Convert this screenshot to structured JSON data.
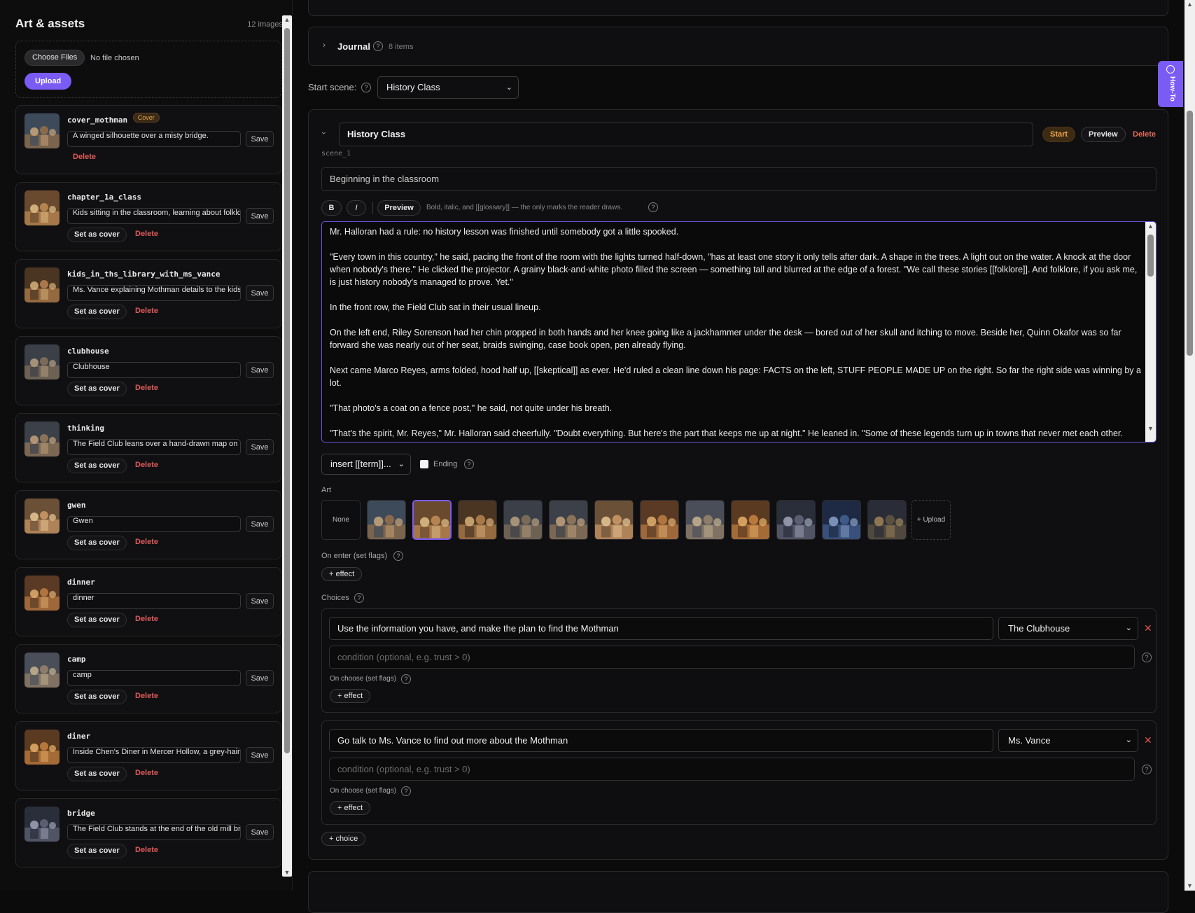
{
  "sidebar": {
    "title": "Art & assets",
    "count": "12 images",
    "choose_files": "Choose Files",
    "no_file": "No file chosen",
    "upload": "Upload",
    "save_label": "Save",
    "set_cover_label": "Set as cover",
    "delete_label": "Delete",
    "cover_badge": "Cover",
    "assets": [
      {
        "name": "cover_mothman",
        "caption": "A winged silhouette over a misty bridge.",
        "is_cover": true
      },
      {
        "name": "chapter_1a_class",
        "caption": "Kids sitting in the classroom, learning about folklore",
        "is_cover": false
      },
      {
        "name": "kids_in_ths_library_with_ms_vance",
        "caption": "Ms. Vance explaining Mothman details to the kids",
        "is_cover": false
      },
      {
        "name": "clubhouse",
        "caption": "Clubhouse",
        "is_cover": false
      },
      {
        "name": "thinking",
        "caption": "The Field Club leans over a hand-drawn map on",
        "is_cover": false
      },
      {
        "name": "gwen",
        "caption": "Gwen",
        "is_cover": false
      },
      {
        "name": "dinner",
        "caption": "dinner",
        "is_cover": false
      },
      {
        "name": "camp",
        "caption": "camp",
        "is_cover": false
      },
      {
        "name": "diner",
        "caption": "Inside Chen's Diner in Mercer Hollow, a grey-haired",
        "is_cover": false
      },
      {
        "name": "bridge",
        "caption": "The Field Club stands at the end of the old mill bridge",
        "is_cover": false
      }
    ]
  },
  "journal": {
    "label": "Journal",
    "count": "8 items"
  },
  "start_scene": {
    "label": "Start scene:",
    "value": "History Class"
  },
  "scene": {
    "title": "History Class",
    "id": "scene_1",
    "summary": "Beginning in the classroom",
    "start_label": "Start",
    "preview_label": "Preview",
    "delete_label": "Delete",
    "toolbar": {
      "bold": "B",
      "italic": "I",
      "preview": "Preview",
      "hint": "Bold, italic, and [[glossary]] — the only marks the reader draws."
    },
    "body": [
      "Mr. Halloran had a rule: no history lesson was finished until somebody got a little spooked.",
      "\"Every town in this country,\" he said, pacing the front of the room with the lights turned half-down, \"has at least one story it only tells after dark. A shape in the trees. A light out on the water. A knock at the door when nobody's there.\" He clicked the projector. A grainy black-and-white photo filled the screen — something tall and blurred at the edge of a forest. \"We call these stories [[folklore]]. And folklore, if you ask me, is just history nobody's managed to prove. Yet.\"",
      "In the front row, the Field Club sat in their usual lineup.",
      "On the left end, Riley Sorenson had her chin propped in both hands and her knee going like a jackhammer under the desk — bored out of her skull and itching to move. Beside her, Quinn Okafor was so far forward she was nearly out of her seat, braids swinging, case book open, pen already flying.",
      "Next came Marco Reyes, arms folded, hood half up, [[skeptical]] as ever. He'd ruled a clean line down his page: FACTS on the left, STUFF PEOPLE MADE UP on the right. So far the right side was winning by a lot.",
      "\"That photo's a coat on a fence post,\" he said, not quite under his breath.",
      "\"That's the spirit, Mr. Reyes,\" Mr. Halloran said cheerfully. \"Doubt everything. But here's the part that keeps me up at night.\" He leaned in. \"Some of these legends turn up in towns that never met each other. Same creature. Same description. A hundred years and a thousand miles apart. How does a story travel like that — if there's nothing real underneath it?\""
    ],
    "insert_label": "insert [[term]]...",
    "ending_label": "Ending",
    "art_label": "Art",
    "art_none": "None",
    "art_upload": "+ Upload",
    "on_enter_label": "On enter (set flags)",
    "effect_label": "+ effect",
    "choices_label": "Choices",
    "on_choose_label": "On choose (set flags)",
    "condition_placeholder": "condition (optional, e.g. trust > 0)",
    "add_choice": "+ choice",
    "choices": [
      {
        "text": "Use the information you have, and make the plan to find the Mothman",
        "target": "The Clubhouse"
      },
      {
        "text": "Go talk to Ms. Vance to find out more about the Mothman",
        "target": "Ms. Vance"
      }
    ]
  },
  "howto": "How-To",
  "colors": {
    "accent": "#7a5cf5",
    "danger": "#e05a5a",
    "start": "#f0a64a"
  }
}
